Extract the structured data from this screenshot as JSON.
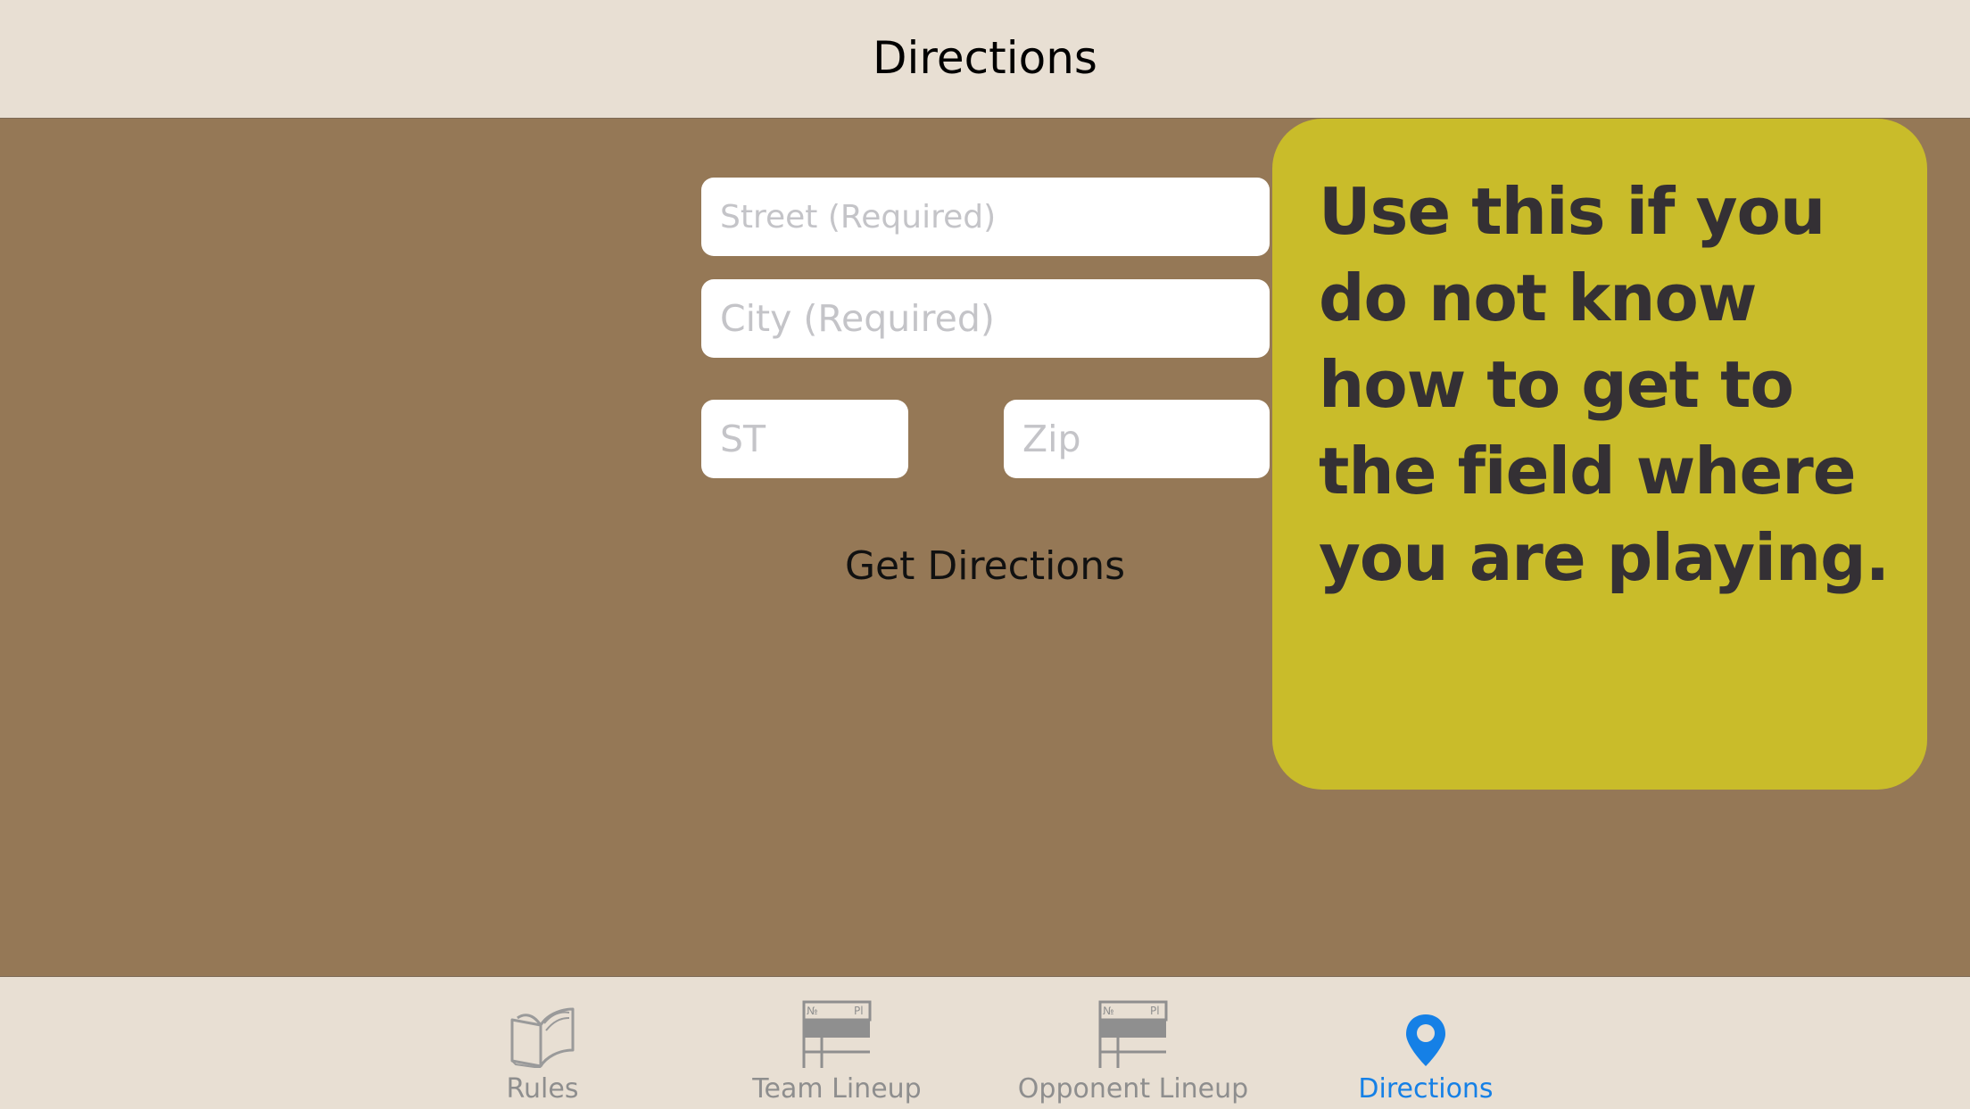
{
  "navbar": {
    "title": "Directions"
  },
  "form": {
    "street_placeholder": "Street (Required)",
    "city_placeholder": "City (Required)",
    "state_placeholder": "ST",
    "zip_placeholder": "Zip",
    "submit_label": "Get Directions"
  },
  "tooltip": {
    "text": "Use this if you do not know how to get to the field where you are playing."
  },
  "tabbar": {
    "tabs": [
      {
        "label": "Rules",
        "icon": "book-icon",
        "active": false
      },
      {
        "label": "Team Lineup",
        "icon": "lineup-card-icon",
        "active": false
      },
      {
        "label": "Opponent Lineup",
        "icon": "lineup-card-icon",
        "active": false
      },
      {
        "label": "Directions",
        "icon": "map-pin-icon",
        "active": true
      }
    ]
  },
  "colors": {
    "background": "#957856",
    "bar_background": "#e8dfd3",
    "tooltip_background": "#c9bc2a",
    "tooltip_text": "#343034",
    "active_tab": "#1580e6",
    "inactive_tab": "#8e8e8e"
  }
}
